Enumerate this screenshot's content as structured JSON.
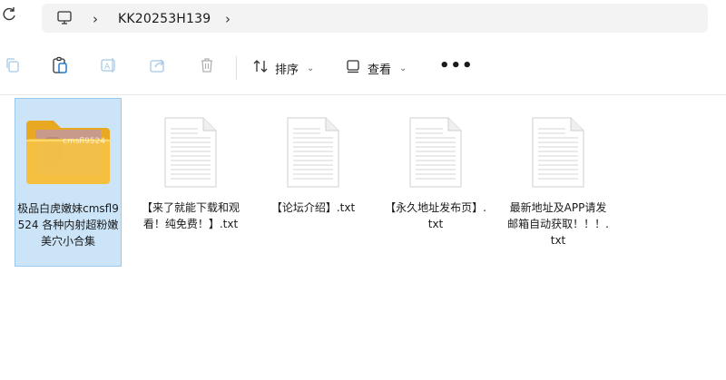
{
  "address_bar": {
    "path": [
      "KK20253H139"
    ]
  },
  "toolbar": {
    "sort_label": "排序",
    "view_label": "查看",
    "more_label": "•••"
  },
  "files": [
    {
      "name": "极品白虎嫩妹cmsfl9524 各种内射超粉嫩美穴小合集",
      "type": "folder",
      "thumb_text": "cmsfl9524"
    },
    {
      "name": "【来了就能下载和观看！纯免费！】.txt",
      "type": "txt"
    },
    {
      "name": "【论坛介绍】.txt",
      "type": "txt"
    },
    {
      "name": "【永久地址发布页】.txt",
      "type": "txt"
    },
    {
      "name": "最新地址及APP请发邮箱自动获取！！！.txt",
      "type": "txt"
    }
  ],
  "colors": {
    "selection_bg": "#cce4f7",
    "folder": "#f5c242"
  }
}
